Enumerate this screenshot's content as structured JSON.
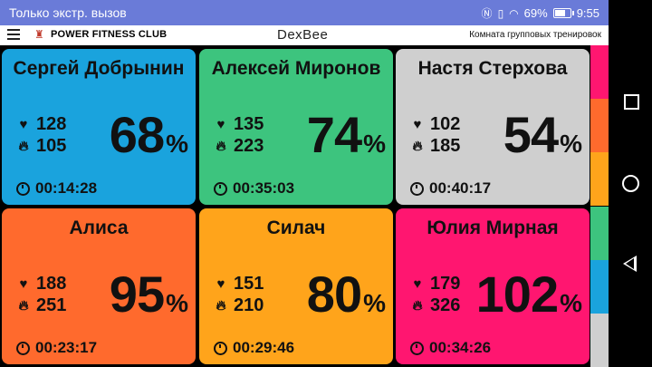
{
  "status_bar": {
    "carrier_text": "Только экстр. вызов",
    "battery_percent": "69%",
    "time": "9:55"
  },
  "app_bar": {
    "club_name": "POWER FITNESS CLUB",
    "brand": "DexBee",
    "room": "Комната групповых тренировок"
  },
  "cards": [
    {
      "name": "Сергей Добрынин",
      "heart_rate": "128",
      "calories": "105",
      "percent": "68",
      "time": "00:14:28",
      "color": "#1aa3dd"
    },
    {
      "name": "Алексей Миронов",
      "heart_rate": "135",
      "calories": "223",
      "percent": "74",
      "time": "00:35:03",
      "color": "#3dc47e"
    },
    {
      "name": "Настя Стерхова",
      "heart_rate": "102",
      "calories": "185",
      "percent": "54",
      "time": "00:40:17",
      "color": "#cfcfcf"
    },
    {
      "name": "Алиса",
      "heart_rate": "188",
      "calories": "251",
      "percent": "95",
      "time": "00:23:17",
      "color": "#ff6a2d"
    },
    {
      "name": "Силач",
      "heart_rate": "151",
      "calories": "210",
      "percent": "80",
      "time": "00:29:46",
      "color": "#ffa41b"
    },
    {
      "name": "Юлия Мирная",
      "heart_rate": "179",
      "calories": "326",
      "percent": "102",
      "time": "00:34:26",
      "color": "#ff1670"
    }
  ],
  "percent_sign": "%",
  "zone_strip_colors": [
    "#ff1670",
    "#ff6a2d",
    "#ffa41b",
    "#3dc47e",
    "#1aa3dd",
    "#cfcfcf"
  ]
}
